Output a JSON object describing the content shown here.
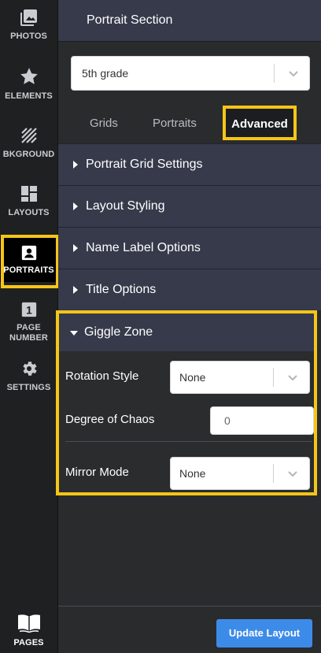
{
  "rail": {
    "items": [
      {
        "label": "PHOTOS",
        "icon": "photos-icon"
      },
      {
        "label": "ELEMENTS",
        "icon": "star-icon"
      },
      {
        "label": "BKGROUND",
        "icon": "background-icon"
      },
      {
        "label": "LAYOUTS",
        "icon": "layouts-icon"
      },
      {
        "label": "PORTRAITS",
        "icon": "portrait-icon",
        "active": true
      },
      {
        "label": "PAGE NUMBER",
        "label_line1": "PAGE",
        "label_line2": "NUMBER",
        "icon": "page-number-icon",
        "badge": "1"
      },
      {
        "label": "SETTINGS",
        "icon": "gear-icon"
      },
      {
        "label": "PAGES",
        "icon": "book-icon"
      }
    ]
  },
  "header": {
    "title": "Portrait Section"
  },
  "grade_select": {
    "value": "5th grade"
  },
  "tabs": [
    {
      "label": "Grids"
    },
    {
      "label": "Portraits"
    },
    {
      "label": "Advanced",
      "active": true
    }
  ],
  "accordion": [
    {
      "label": "Portrait Grid Settings"
    },
    {
      "label": "Layout Styling"
    },
    {
      "label": "Name Label Options"
    },
    {
      "label": "Title Options"
    }
  ],
  "giggle_zone": {
    "title": "Giggle Zone",
    "rotation_style": {
      "label": "Rotation Style",
      "value": "None"
    },
    "degree_of_chaos": {
      "label": "Degree of Chaos",
      "value": "0"
    },
    "mirror_mode": {
      "label": "Mirror Mode",
      "value": "None"
    }
  },
  "footer": {
    "update_button": "Update Layout"
  },
  "colors": {
    "accent": "#3d8be8",
    "highlight": "#f5c518",
    "panel": "#363a4b"
  }
}
